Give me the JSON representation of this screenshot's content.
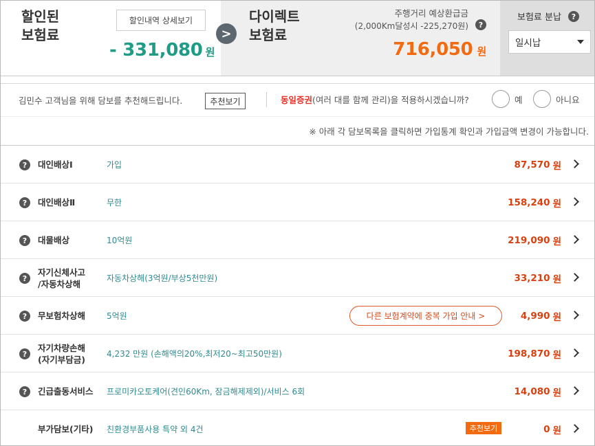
{
  "header": {
    "discount": {
      "title_line1": "할인된",
      "title_line2": "보험료",
      "detail_button": "할인내역 상세보기",
      "amount": "- 331,080",
      "unit": "원"
    },
    "arrow_glyph": ">",
    "direct": {
      "title_line1": "다이렉트",
      "title_line2": "보험료",
      "refund_label": "주행거리 예상환급금",
      "refund_sub": "(2,000Km달성시 -225,270원)",
      "amount": "716,050",
      "unit": "원"
    },
    "installment": {
      "label": "보험료 분납",
      "selected": "일시납"
    }
  },
  "recommend": {
    "text": "김민수 고객님을 위해 담보를 추천해드립니다.",
    "button": "추천보기",
    "joint_highlight": "동일증권",
    "joint_question": "(여러 대를 함께 관리)을 적용하시겠습니까?",
    "yes": "예",
    "no": "아니요"
  },
  "notice": "※ 아래 각 담보목록을 클릭하면 가입통계 확인과 가입금액 변경이 가능합니다.",
  "coverages": [
    {
      "name": "대인배상Ⅰ",
      "value": "가입",
      "price": "87,570",
      "unit": "원"
    },
    {
      "name": "대인배상Ⅱ",
      "value": "무한",
      "price": "158,240",
      "unit": "원"
    },
    {
      "name": "대물배상",
      "value": "10억원",
      "price": "219,090",
      "unit": "원"
    },
    {
      "name": "자기신체사고\n/자동차상해",
      "value": "자동차상해(3억원/부상5천만원)",
      "price": "33,210",
      "unit": "원"
    },
    {
      "name": "무보험차상해",
      "value": "5억원",
      "price": "4,990",
      "unit": "원",
      "dup_button": "다른 보험계약에 중복 가입 안내 >"
    },
    {
      "name": "자기차량손해\n(자기부담금)",
      "value": "4,232 만원 (손해액의20%,최저20~최고50만원)",
      "price": "198,870",
      "unit": "원"
    },
    {
      "name": "긴급출동서비스",
      "value": "프로미카오토케어(견인60Km, 잠금해제제외)/서비스 6회",
      "price": "14,080",
      "unit": "원"
    },
    {
      "name": "부가담보(기타)",
      "value": "친환경부품사용 특약 외 4건",
      "price": "0",
      "unit": "원",
      "tag": "추천보기"
    }
  ],
  "colors": {
    "discount": "#1f9c85",
    "direct": "#f26b11",
    "price": "#d9400f",
    "value": "#2f8a8f",
    "highlight": "#e4342a"
  },
  "icons": {
    "help": "question-circle-icon",
    "arrow": "arrow-right-circle-icon",
    "chevron": "chevron-right-icon",
    "caret": "caret-down-icon"
  }
}
